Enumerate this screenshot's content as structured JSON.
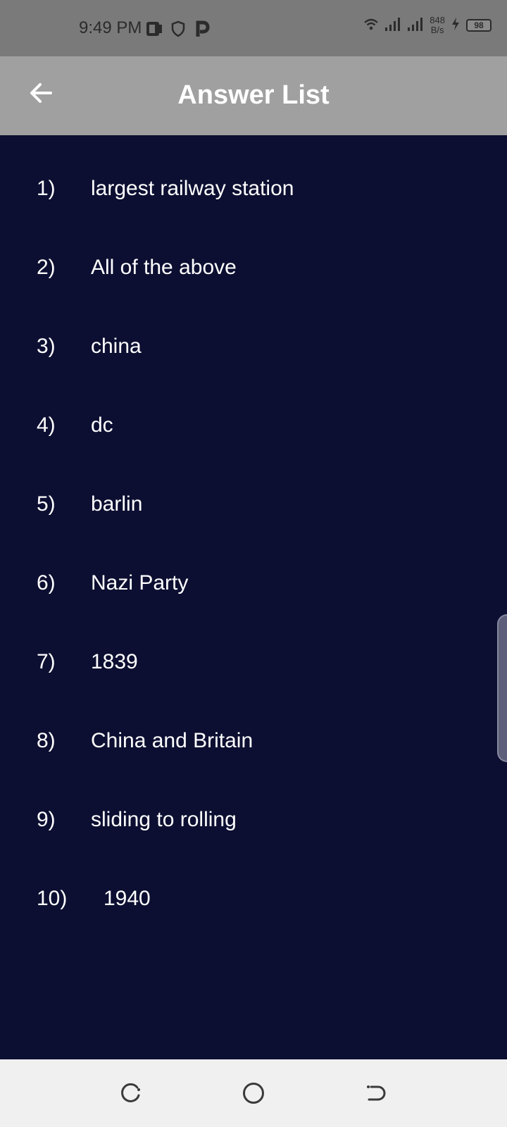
{
  "status_bar": {
    "time": "9:49 PM",
    "net_speed_value": "848",
    "net_speed_unit": "B/s",
    "battery": "98"
  },
  "app_bar": {
    "title": "Answer List"
  },
  "answers": [
    {
      "num": "1)",
      "text": "largest railway station"
    },
    {
      "num": "2)",
      "text": "All of the above"
    },
    {
      "num": "3)",
      "text": "china"
    },
    {
      "num": "4)",
      "text": "dc"
    },
    {
      "num": "5)",
      "text": "barlin"
    },
    {
      "num": "6)",
      "text": "Nazi Party"
    },
    {
      "num": "7)",
      "text": "1839"
    },
    {
      "num": "8)",
      "text": "China and Britain"
    },
    {
      "num": "9)",
      "text": "sliding to rolling"
    },
    {
      "num": "10)",
      "text": "1940"
    }
  ],
  "icons": {
    "back": "arrow-left-icon",
    "recent": "recent-apps-icon",
    "home": "home-icon",
    "nav_back": "back-icon"
  },
  "colors": {
    "background": "#0c0f31",
    "app_bar": "#a0a0a0",
    "status_bar": "#7a7a7a",
    "nav_bar": "#f0f0f0"
  }
}
